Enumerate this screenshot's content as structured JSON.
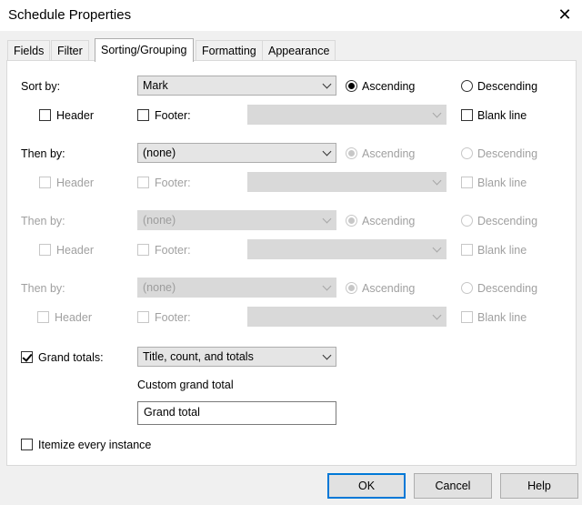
{
  "window": {
    "title": "Schedule Properties"
  },
  "tabs": [
    "Fields",
    "Filter",
    "Sorting/Grouping",
    "Formatting",
    "Appearance"
  ],
  "sort_rows": [
    {
      "label": "Sort by:",
      "field": "Mark",
      "ascending": "Ascending",
      "descending": "Descending",
      "header": "Header",
      "footer": "Footer:",
      "footer_value": "",
      "blank_line": "Blank line"
    },
    {
      "label": "Then by:",
      "field": "(none)",
      "ascending": "Ascending",
      "descending": "Descending",
      "header": "Header",
      "footer": "Footer:",
      "footer_value": "",
      "blank_line": "Blank line"
    },
    {
      "label": "Then by:",
      "field": "(none)",
      "ascending": "Ascending",
      "descending": "Descending",
      "header": "Header",
      "footer": "Footer:",
      "footer_value": "",
      "blank_line": "Blank line"
    },
    {
      "label": "Then by:",
      "field": "(none)",
      "ascending": "Ascending",
      "descending": "Descending",
      "header": "Header",
      "footer": "Footer:",
      "footer_value": "",
      "blank_line": "Blank line"
    }
  ],
  "grand_totals": {
    "label": "Grand totals:",
    "value": "Title, count, and totals",
    "custom_label": "Custom grand total",
    "custom_value": "Grand total"
  },
  "itemize": {
    "label": "Itemize every instance"
  },
  "buttons": {
    "ok": "OK",
    "cancel": "Cancel",
    "help": "Help"
  },
  "icons": {
    "close": "close-icon",
    "dropdown": "chevron-down-icon"
  }
}
